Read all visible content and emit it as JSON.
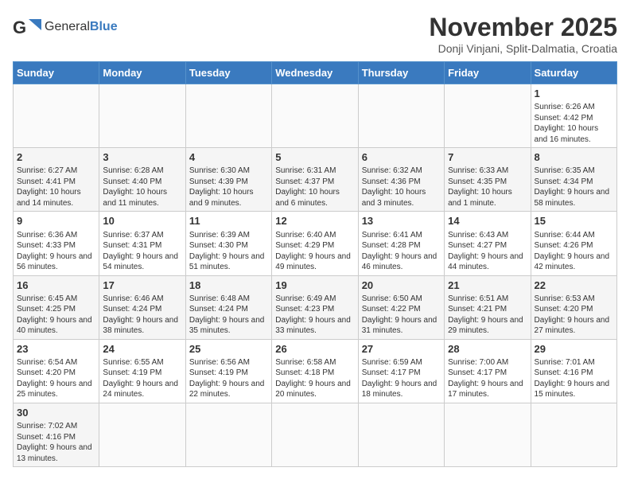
{
  "logo": {
    "text_general": "General",
    "text_blue": "Blue"
  },
  "title": "November 2025",
  "subtitle": "Donji Vinjani, Split-Dalmatia, Croatia",
  "headers": [
    "Sunday",
    "Monday",
    "Tuesday",
    "Wednesday",
    "Thursday",
    "Friday",
    "Saturday"
  ],
  "weeks": [
    [
      {
        "day": "",
        "content": ""
      },
      {
        "day": "",
        "content": ""
      },
      {
        "day": "",
        "content": ""
      },
      {
        "day": "",
        "content": ""
      },
      {
        "day": "",
        "content": ""
      },
      {
        "day": "",
        "content": ""
      },
      {
        "day": "1",
        "content": "Sunrise: 6:26 AM\nSunset: 4:42 PM\nDaylight: 10 hours and 16 minutes."
      }
    ],
    [
      {
        "day": "2",
        "content": "Sunrise: 6:27 AM\nSunset: 4:41 PM\nDaylight: 10 hours and 14 minutes."
      },
      {
        "day": "3",
        "content": "Sunrise: 6:28 AM\nSunset: 4:40 PM\nDaylight: 10 hours and 11 minutes."
      },
      {
        "day": "4",
        "content": "Sunrise: 6:30 AM\nSunset: 4:39 PM\nDaylight: 10 hours and 9 minutes."
      },
      {
        "day": "5",
        "content": "Sunrise: 6:31 AM\nSunset: 4:37 PM\nDaylight: 10 hours and 6 minutes."
      },
      {
        "day": "6",
        "content": "Sunrise: 6:32 AM\nSunset: 4:36 PM\nDaylight: 10 hours and 3 minutes."
      },
      {
        "day": "7",
        "content": "Sunrise: 6:33 AM\nSunset: 4:35 PM\nDaylight: 10 hours and 1 minute."
      },
      {
        "day": "8",
        "content": "Sunrise: 6:35 AM\nSunset: 4:34 PM\nDaylight: 9 hours and 58 minutes."
      }
    ],
    [
      {
        "day": "9",
        "content": "Sunrise: 6:36 AM\nSunset: 4:33 PM\nDaylight: 9 hours and 56 minutes."
      },
      {
        "day": "10",
        "content": "Sunrise: 6:37 AM\nSunset: 4:31 PM\nDaylight: 9 hours and 54 minutes."
      },
      {
        "day": "11",
        "content": "Sunrise: 6:39 AM\nSunset: 4:30 PM\nDaylight: 9 hours and 51 minutes."
      },
      {
        "day": "12",
        "content": "Sunrise: 6:40 AM\nSunset: 4:29 PM\nDaylight: 9 hours and 49 minutes."
      },
      {
        "day": "13",
        "content": "Sunrise: 6:41 AM\nSunset: 4:28 PM\nDaylight: 9 hours and 46 minutes."
      },
      {
        "day": "14",
        "content": "Sunrise: 6:43 AM\nSunset: 4:27 PM\nDaylight: 9 hours and 44 minutes."
      },
      {
        "day": "15",
        "content": "Sunrise: 6:44 AM\nSunset: 4:26 PM\nDaylight: 9 hours and 42 minutes."
      }
    ],
    [
      {
        "day": "16",
        "content": "Sunrise: 6:45 AM\nSunset: 4:25 PM\nDaylight: 9 hours and 40 minutes."
      },
      {
        "day": "17",
        "content": "Sunrise: 6:46 AM\nSunset: 4:24 PM\nDaylight: 9 hours and 38 minutes."
      },
      {
        "day": "18",
        "content": "Sunrise: 6:48 AM\nSunset: 4:24 PM\nDaylight: 9 hours and 35 minutes."
      },
      {
        "day": "19",
        "content": "Sunrise: 6:49 AM\nSunset: 4:23 PM\nDaylight: 9 hours and 33 minutes."
      },
      {
        "day": "20",
        "content": "Sunrise: 6:50 AM\nSunset: 4:22 PM\nDaylight: 9 hours and 31 minutes."
      },
      {
        "day": "21",
        "content": "Sunrise: 6:51 AM\nSunset: 4:21 PM\nDaylight: 9 hours and 29 minutes."
      },
      {
        "day": "22",
        "content": "Sunrise: 6:53 AM\nSunset: 4:20 PM\nDaylight: 9 hours and 27 minutes."
      }
    ],
    [
      {
        "day": "23",
        "content": "Sunrise: 6:54 AM\nSunset: 4:20 PM\nDaylight: 9 hours and 25 minutes."
      },
      {
        "day": "24",
        "content": "Sunrise: 6:55 AM\nSunset: 4:19 PM\nDaylight: 9 hours and 24 minutes."
      },
      {
        "day": "25",
        "content": "Sunrise: 6:56 AM\nSunset: 4:19 PM\nDaylight: 9 hours and 22 minutes."
      },
      {
        "day": "26",
        "content": "Sunrise: 6:58 AM\nSunset: 4:18 PM\nDaylight: 9 hours and 20 minutes."
      },
      {
        "day": "27",
        "content": "Sunrise: 6:59 AM\nSunset: 4:17 PM\nDaylight: 9 hours and 18 minutes."
      },
      {
        "day": "28",
        "content": "Sunrise: 7:00 AM\nSunset: 4:17 PM\nDaylight: 9 hours and 17 minutes."
      },
      {
        "day": "29",
        "content": "Sunrise: 7:01 AM\nSunset: 4:16 PM\nDaylight: 9 hours and 15 minutes."
      }
    ],
    [
      {
        "day": "30",
        "content": "Sunrise: 7:02 AM\nSunset: 4:16 PM\nDaylight: 9 hours and 13 minutes."
      },
      {
        "day": "",
        "content": ""
      },
      {
        "day": "",
        "content": ""
      },
      {
        "day": "",
        "content": ""
      },
      {
        "day": "",
        "content": ""
      },
      {
        "day": "",
        "content": ""
      },
      {
        "day": "",
        "content": ""
      }
    ]
  ]
}
